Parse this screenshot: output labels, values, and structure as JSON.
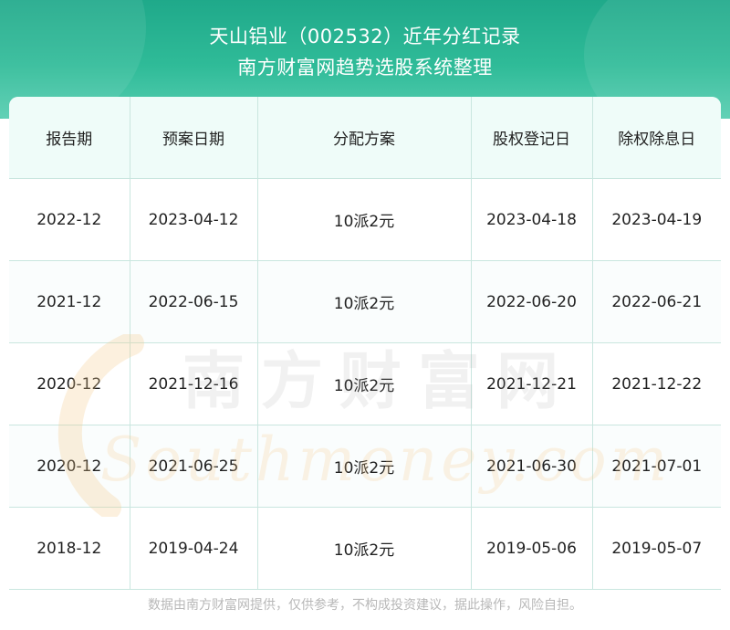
{
  "header": {
    "title": "天山铝业（002532）近年分红记录",
    "subtitle": "南方财富网趋势选股系统整理"
  },
  "table": {
    "columns": [
      "报告期",
      "预案日期",
      "分配方案",
      "股权登记日",
      "除权除息日"
    ],
    "rows": [
      [
        "2022-12",
        "2023-04-12",
        "10派2元",
        "2023-04-18",
        "2023-04-19"
      ],
      [
        "2021-12",
        "2022-06-15",
        "10派2元",
        "2022-06-20",
        "2022-06-21"
      ],
      [
        "2020-12",
        "2021-12-16",
        "10派2元",
        "2021-12-21",
        "2021-12-22"
      ],
      [
        "2020-12",
        "2021-06-25",
        "10派2元",
        "2021-06-30",
        "2021-07-01"
      ],
      [
        "2018-12",
        "2019-04-24",
        "10派2元",
        "2019-05-06",
        "2019-05-07"
      ]
    ]
  },
  "watermark": {
    "cn": "南方财富网",
    "en": "Southmoney.com"
  },
  "footer": {
    "disclaimer": "数据由南方财富网提供，仅供参考，不构成投资建议，据此操作，风险自担。"
  },
  "colors": {
    "header_green": "#2fbb98",
    "header_row_bg": "#effcf9",
    "grid_line": "#c9e6df",
    "footer_text": "#b8b8b8"
  }
}
